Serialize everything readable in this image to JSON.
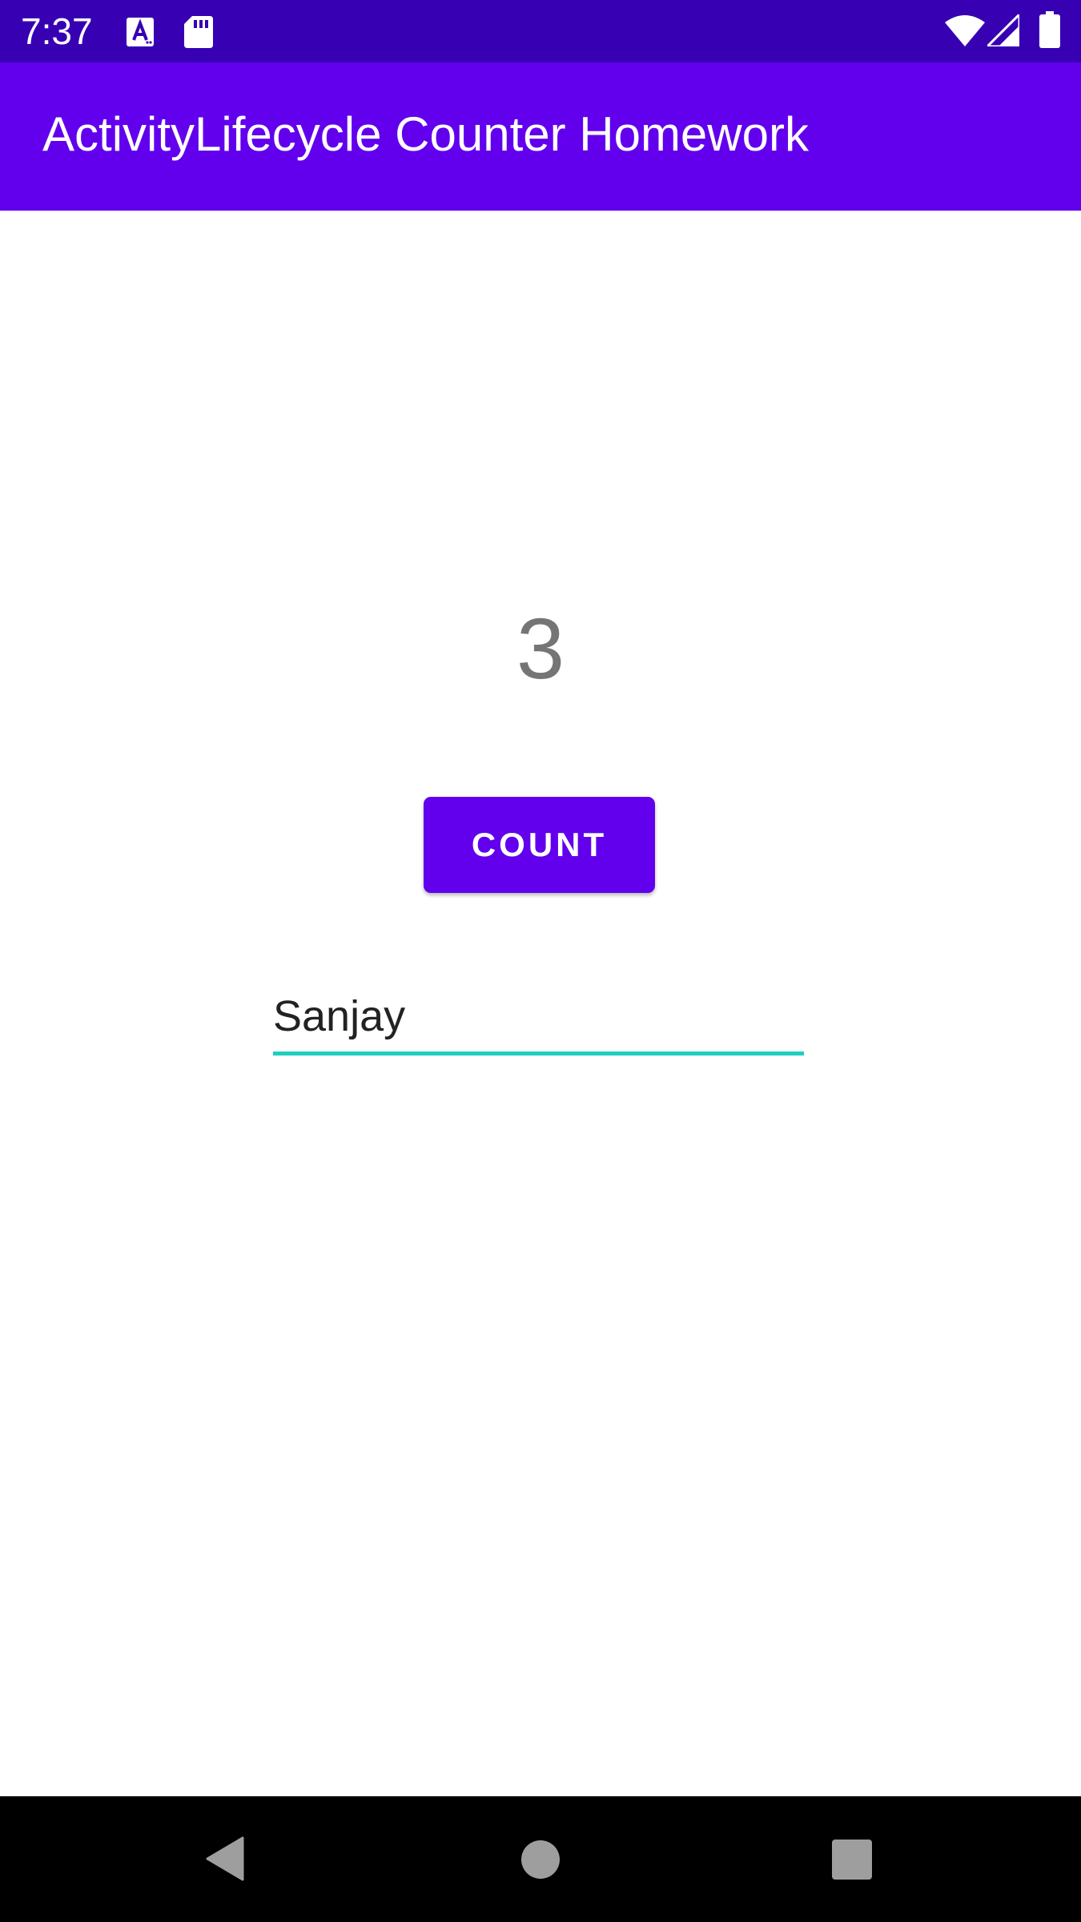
{
  "status_bar": {
    "time": "7:37",
    "background_color": "#3700b3",
    "left_icons": [
      "accessibility-a-icon",
      "sd-card-icon"
    ],
    "right_icons": [
      "wifi-icon",
      "cell-signal-icon",
      "battery-icon"
    ]
  },
  "app_bar": {
    "title": "ActivityLifecycle Counter Homework",
    "background_color": "#6200ee"
  },
  "counter": {
    "value": "3"
  },
  "count_button": {
    "label": "COUNT",
    "color": "#6200ee"
  },
  "name_field": {
    "value": "Sanjay",
    "underline_color": "#1fcfc0"
  },
  "nav_bar": {
    "buttons": [
      "back-icon",
      "home-icon",
      "recents-icon"
    ]
  }
}
